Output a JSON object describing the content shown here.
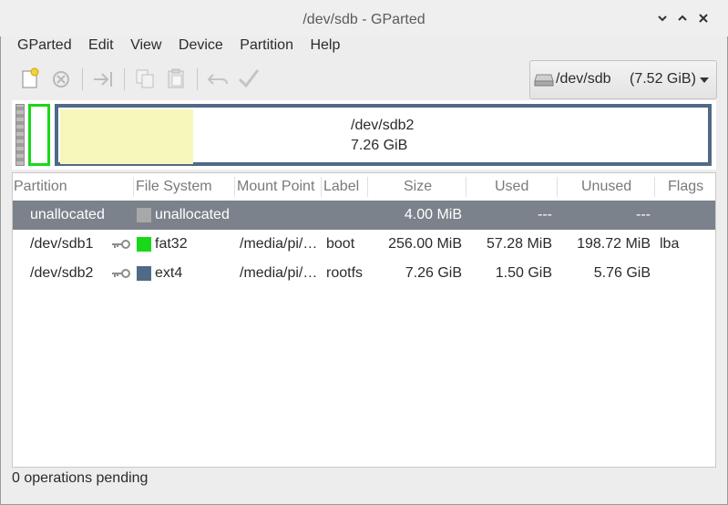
{
  "window": {
    "title": "/dev/sdb - GParted"
  },
  "menu": [
    "GParted",
    "Edit",
    "View",
    "Device",
    "Partition",
    "Help"
  ],
  "device_selector": {
    "device": "/dev/sdb",
    "size": "(7.52 GiB)"
  },
  "partition_map": {
    "name": "/dev/sdb2",
    "size": "7.26 GiB"
  },
  "table": {
    "headers": [
      "Partition",
      "File System",
      "Mount Point",
      "Label",
      "Size",
      "Used",
      "Unused",
      "Flags"
    ],
    "rows": [
      {
        "partition": "unallocated",
        "fs": "unallocated",
        "mount": "",
        "label": "",
        "size": "4.00 MiB",
        "used": "---",
        "unused": "---",
        "flags": "",
        "fs_color": "#a8a8a8",
        "has_key": false
      },
      {
        "partition": "/dev/sdb1",
        "fs": "fat32",
        "mount": "/media/pi/…",
        "label": "boot",
        "size": "256.00 MiB",
        "used": "57.28 MiB",
        "unused": "198.72 MiB",
        "flags": "lba",
        "fs_color": "#18d818",
        "has_key": true
      },
      {
        "partition": "/dev/sdb2",
        "fs": "ext4",
        "mount": "/media/pi/…",
        "label": "rootfs",
        "size": "7.26 GiB",
        "used": "1.50 GiB",
        "unused": "5.76 GiB",
        "flags": "",
        "fs_color": "#4f6a86",
        "has_key": true
      }
    ]
  },
  "status": "0 operations pending"
}
